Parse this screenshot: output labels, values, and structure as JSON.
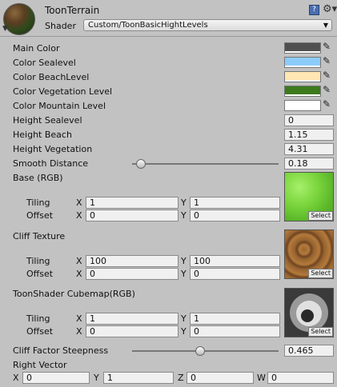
{
  "header": {
    "title": "ToonTerrain",
    "shader_label": "Shader",
    "shader_value": "Custom/ToonBasicHightLevels"
  },
  "colors": [
    {
      "label": "Main Color",
      "hex": "#505050"
    },
    {
      "label": "Color Sealevel",
      "hex": "#8cccfa"
    },
    {
      "label": "Color BeachLevel",
      "hex": "#ffe6b2"
    },
    {
      "label": "Color Vegetation Level",
      "hex": "#3d7a1c"
    },
    {
      "label": "Color Mountain Level",
      "hex": "#ffffff"
    }
  ],
  "floats": [
    {
      "label": "Height Sealevel",
      "value": "0"
    },
    {
      "label": "Height Beach",
      "value": "1.15"
    },
    {
      "label": "Height Vegetation",
      "value": "4.31"
    }
  ],
  "smooth": {
    "label": "Smooth Distance",
    "value": "0.18",
    "fraction": 0.06
  },
  "textures": [
    {
      "label": "Base (RGB)",
      "tiling_x": "1",
      "tiling_y": "1",
      "offset_x": "0",
      "offset_y": "0",
      "preview": "grass"
    },
    {
      "label": "Cliff Texture",
      "tiling_x": "100",
      "tiling_y": "100",
      "offset_x": "0",
      "offset_y": "0",
      "preview": "rock"
    },
    {
      "label": "ToonShader Cubemap(RGB)",
      "tiling_x": "1",
      "tiling_y": "1",
      "offset_x": "0",
      "offset_y": "0",
      "preview": "cubemap"
    }
  ],
  "common": {
    "tiling": "Tiling",
    "offset": "Offset",
    "x": "X",
    "y": "Y",
    "z": "Z",
    "w": "W",
    "select": "Select"
  },
  "cliff": {
    "label": "Cliff Factor Steepness",
    "value": "0.465",
    "fraction": 0.465
  },
  "right_vector": {
    "label": "Right Vector",
    "x": "0",
    "y": "1",
    "z": "0",
    "w": "0"
  }
}
